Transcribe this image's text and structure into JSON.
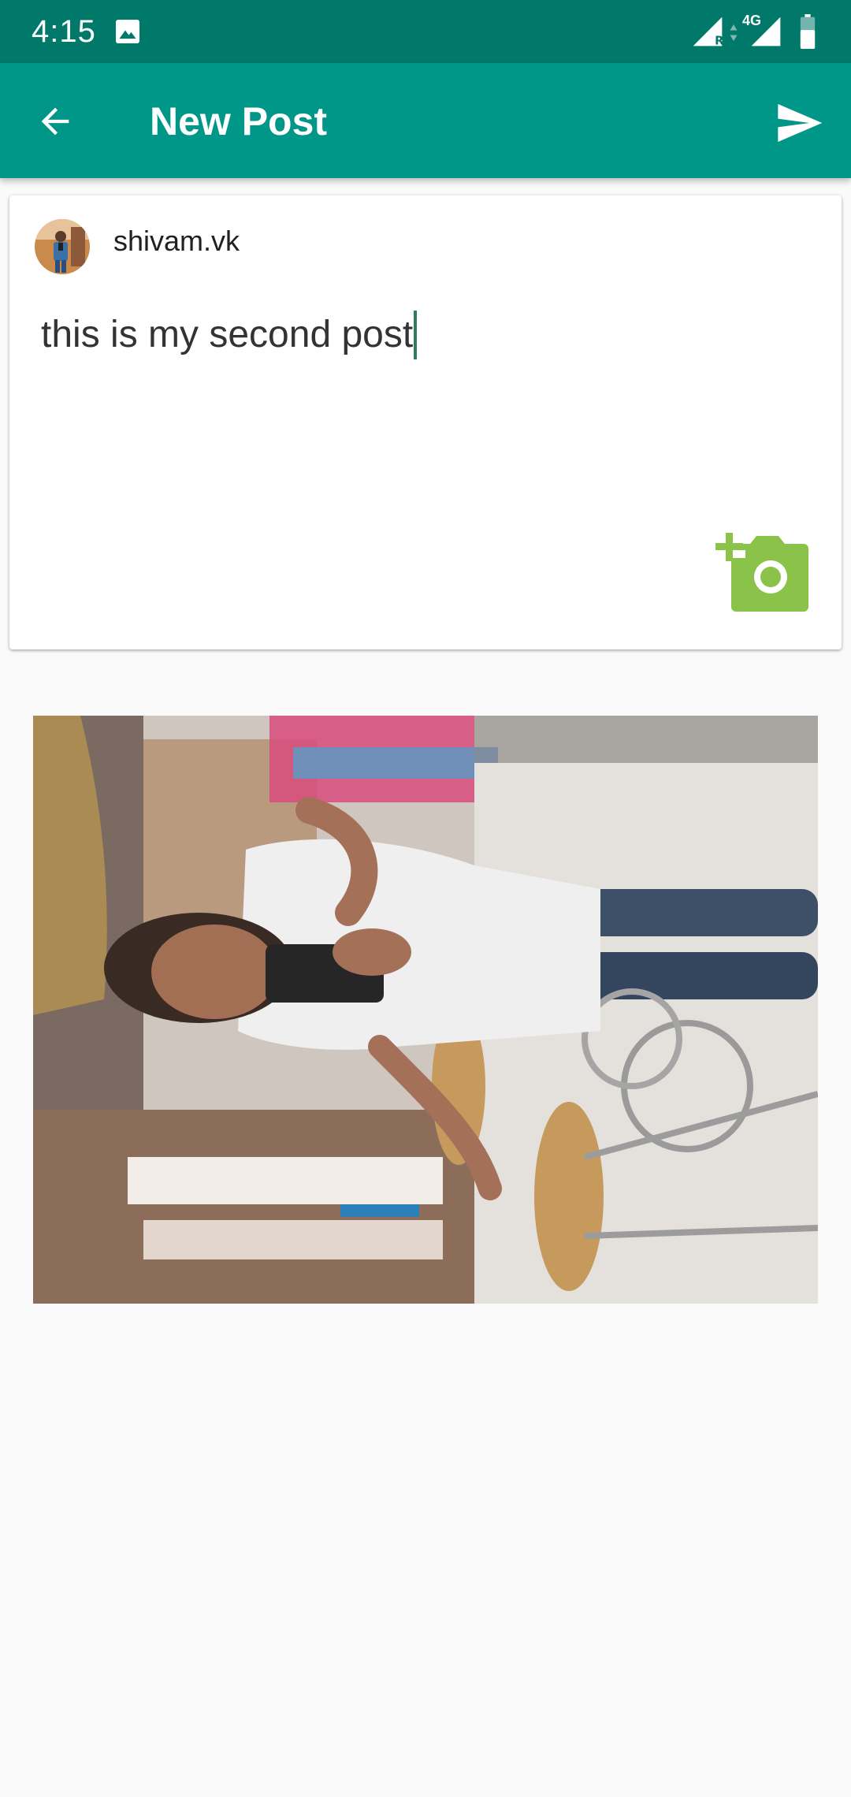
{
  "status_bar": {
    "time": "4:15",
    "network_type": "4G",
    "background": "#00796b",
    "icons": [
      "gallery-icon",
      "signal-roaming-icon",
      "data-arrows-icon",
      "signal-4g-icon",
      "battery-icon"
    ]
  },
  "app_bar": {
    "title": "New Post",
    "background": "#009688",
    "back_icon": "arrow-back-icon",
    "send_icon": "send-icon"
  },
  "post": {
    "username": "shivam.vk",
    "text": "this is my second post",
    "add_photo_icon": "add-photo-camera-icon",
    "accent": "#8bc34a"
  }
}
